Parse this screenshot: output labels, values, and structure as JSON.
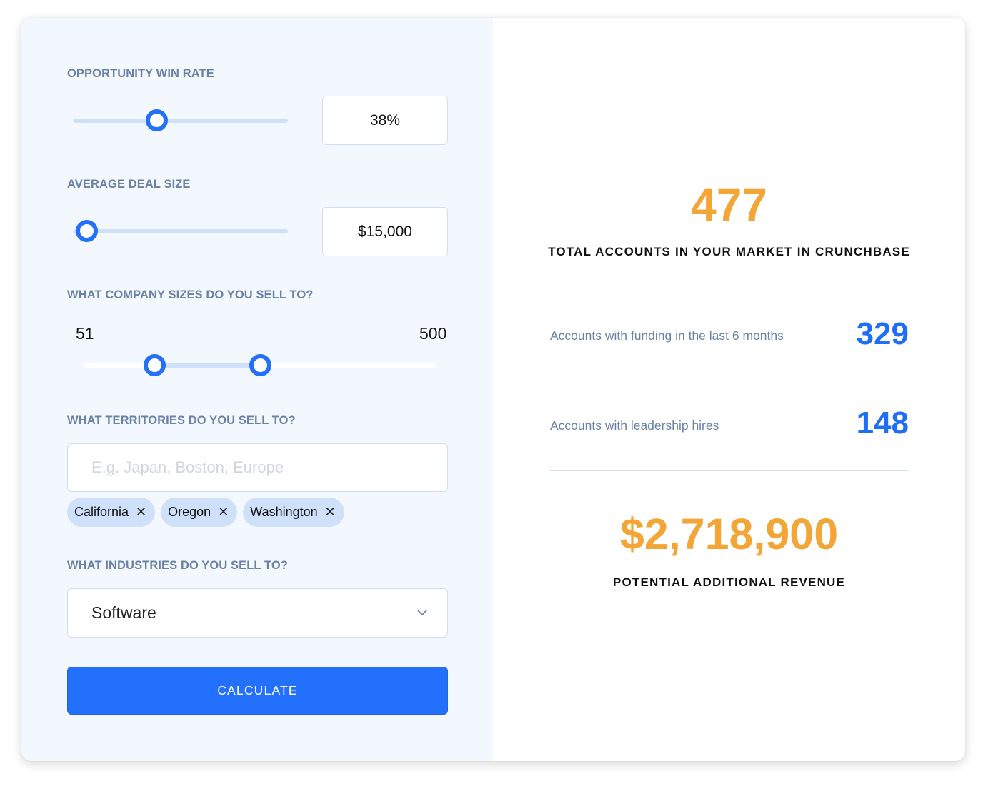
{
  "form": {
    "win_rate": {
      "label": "OPPORTUNITY WIN RATE",
      "value_text": "38%",
      "slider_fraction": 0.38
    },
    "deal_size": {
      "label": "AVERAGE DEAL SIZE",
      "value_text": "$15,000",
      "slider_fraction": 0.04
    },
    "company_sizes": {
      "label": "WHAT COMPANY SIZES DO YOU SELL TO?",
      "min_text": "51",
      "max_text": "500",
      "range_fraction_low": 0.2,
      "range_fraction_high": 0.5
    },
    "territories": {
      "label": "WHAT TERRITORIES DO YOU SELL TO?",
      "placeholder": "E.g. Japan, Boston, Europe",
      "tags": [
        "California",
        "Oregon",
        "Washington"
      ],
      "remove_glyph": "✕"
    },
    "industries": {
      "label": "WHAT INDUSTRIES DO YOU SELL TO?",
      "selected": "Software"
    },
    "calculate_label": "CALCULATE"
  },
  "results": {
    "total_accounts": "477",
    "total_accounts_caption": "TOTAL ACCOUNTS IN YOUR MARKET IN CRUNCHBASE",
    "stats": [
      {
        "label": "Accounts with funding in the last 6 months",
        "value": "329"
      },
      {
        "label": "Accounts with leadership hires",
        "value": "148"
      }
    ],
    "revenue": "$2,718,900",
    "revenue_caption": "POTENTIAL ADDITIONAL REVENUE"
  },
  "colors": {
    "accent_blue": "#2270fb",
    "result_orange": "#f3a536",
    "label_slate": "#6a81a6"
  }
}
